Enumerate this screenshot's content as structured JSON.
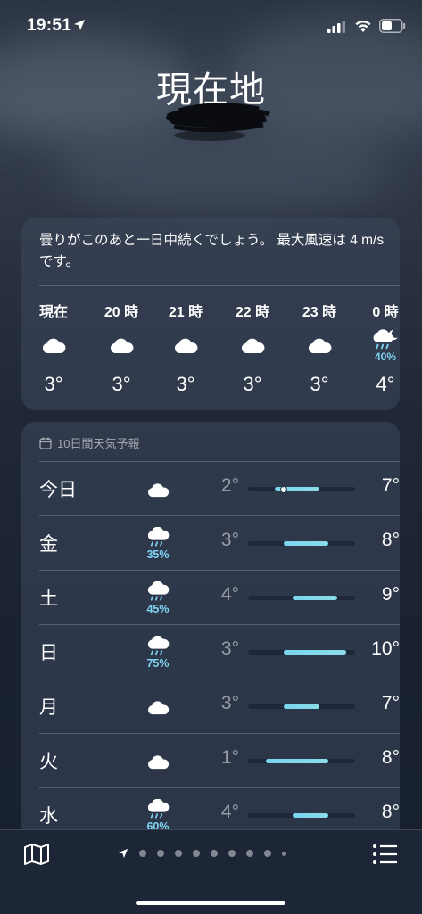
{
  "status_bar": {
    "time": "19:51"
  },
  "location": {
    "title": "現在地"
  },
  "hourly": {
    "summary": "曇りがこのあと一日中続くでしょう。 最大風速は 4 m/s です。",
    "hours": [
      {
        "label": "現在",
        "icon": "cloud-icon",
        "temp": "3°",
        "precip": ""
      },
      {
        "label": "20 時",
        "icon": "cloud-icon",
        "temp": "3°",
        "precip": ""
      },
      {
        "label": "21 時",
        "icon": "cloud-icon",
        "temp": "3°",
        "precip": ""
      },
      {
        "label": "22 時",
        "icon": "cloud-icon",
        "temp": "3°",
        "precip": ""
      },
      {
        "label": "23 時",
        "icon": "cloud-icon",
        "temp": "3°",
        "precip": ""
      },
      {
        "label": "0 時",
        "icon": "cloud-moon-rain-icon",
        "temp": "4°",
        "precip": "40%"
      }
    ]
  },
  "daily": {
    "header": "10日間天気予報",
    "range_low": -1,
    "range_high": 11,
    "current_temp": 3,
    "days": [
      {
        "day": "今日",
        "icon": "cloud-icon",
        "precip": "",
        "low": "2°",
        "high": "7°",
        "low_val": 2,
        "high_val": 7,
        "is_today": true
      },
      {
        "day": "金",
        "icon": "cloud-rain-icon",
        "precip": "35%",
        "low": "3°",
        "high": "8°",
        "low_val": 3,
        "high_val": 8
      },
      {
        "day": "土",
        "icon": "cloud-rain-icon",
        "precip": "45%",
        "low": "4°",
        "high": "9°",
        "low_val": 4,
        "high_val": 9
      },
      {
        "day": "日",
        "icon": "cloud-rain-icon",
        "precip": "75%",
        "low": "3°",
        "high": "10°",
        "low_val": 3,
        "high_val": 10
      },
      {
        "day": "月",
        "icon": "cloud-icon",
        "precip": "",
        "low": "3°",
        "high": "7°",
        "low_val": 3,
        "high_val": 7
      },
      {
        "day": "火",
        "icon": "cloud-icon",
        "precip": "",
        "low": "1°",
        "high": "8°",
        "low_val": 1,
        "high_val": 8
      },
      {
        "day": "水",
        "icon": "cloud-rain-icon",
        "precip": "60%",
        "low": "4°",
        "high": "8°",
        "low_val": 4,
        "high_val": 8
      }
    ]
  },
  "colors": {
    "accent_precip": "#7fd3f2",
    "temp_bar": "#79d5ee"
  }
}
